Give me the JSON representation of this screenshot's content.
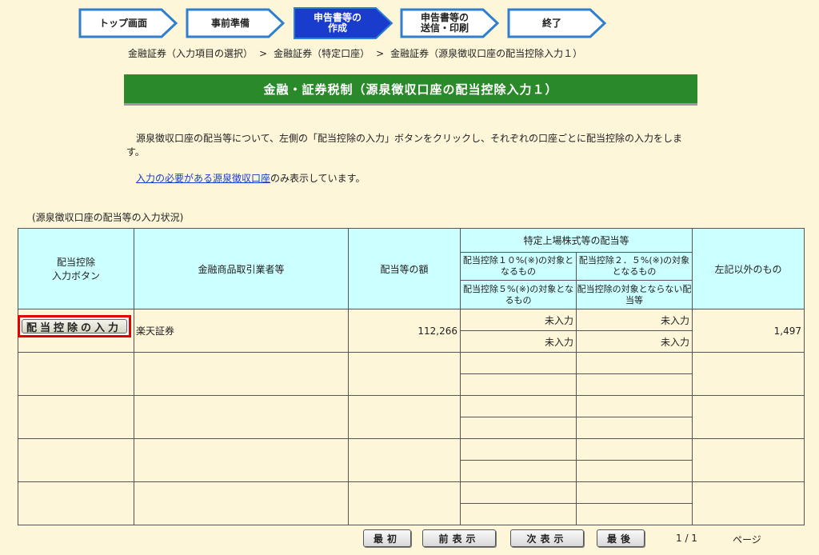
{
  "steps": [
    {
      "label": "トップ画面",
      "active": false
    },
    {
      "label": "事前準備",
      "active": false
    },
    {
      "label": "申告書等の\n作成",
      "active": true
    },
    {
      "label": "申告書等の\n送信・印刷",
      "active": false
    },
    {
      "label": "終了",
      "active": false
    }
  ],
  "breadcrumb": {
    "items": [
      "金融証券（入力項目の選択）",
      "金融証券（特定口座）",
      "金融証券（源泉徴収口座の配当控除入力１）"
    ],
    "separator": ">"
  },
  "title": "金融・証券税制（源泉徴収口座の配当控除入力１）",
  "description": "源泉徴収口座の配当等について、左側の「配当控除の入力」ボタンをクリックし、それぞれの口座ごとに配当控除の入力をします。",
  "note": {
    "link": "入力の必要がある源泉徴収口座",
    "text": "のみ表示しています。"
  },
  "table_caption": "(源泉徴収口座の配当等の入力状況)",
  "table": {
    "headers": {
      "button_col": "配当控除\n入力ボタン",
      "broker_col": "金融商品取引業者等",
      "amount_col": "配当等の額",
      "specific_group": "特定上場株式等の配当等",
      "sub_10": "配当控除１０%(※)の対象となるもの",
      "sub_25": "配当控除２．５%(※)の対象となるもの",
      "sub_5": "配当控除５%(※)の対象となるもの",
      "sub_none": "配当控除の対象とならない配当等",
      "other_col": "左記以外のもの"
    },
    "rows": [
      {
        "button": "配当控除の入力",
        "broker": "楽天証券",
        "amount": "112,266",
        "sub_10": "未入力",
        "sub_25": "未入力",
        "sub_5": "未入力",
        "sub_none": "未入力",
        "other": "1,497"
      }
    ]
  },
  "pager": {
    "first": "最初",
    "prev": "前表示",
    "next": "次表示",
    "last": "最後",
    "info": "1 / 1",
    "unit": "ページ"
  },
  "colors": {
    "background": "#fdf6d9",
    "title_bar": "#2a8a2a",
    "header_cell": "#ccffff",
    "active_step": "#1a3ccc",
    "highlight": "#e00000"
  }
}
